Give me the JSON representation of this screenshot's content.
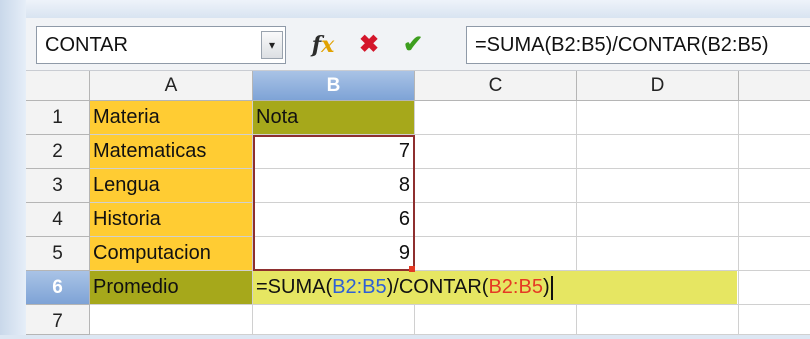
{
  "toolbar": {
    "name_box": "CONTAR",
    "dropdown_glyph": "▾",
    "function_wizard_icon": "fx",
    "cancel_icon": "✖",
    "accept_icon": "✔",
    "formula": "=SUMA(B2:B5)/CONTAR(B2:B5)"
  },
  "columns": [
    "A",
    "B",
    "C",
    "D"
  ],
  "rows": [
    "1",
    "2",
    "3",
    "4",
    "5",
    "6",
    "7"
  ],
  "cells": {
    "A1": "Materia",
    "B1": "Nota",
    "A2": "Matematicas",
    "B2": "7",
    "A3": "Lengua",
    "B3": "8",
    "A4": "Historia",
    "B4": "6",
    "A5": "Computacion",
    "B5": "9",
    "A6": "Promedio"
  },
  "editing_formula": {
    "p1": "=SUMA(",
    "r1": "B2:B5",
    "p2": ")/CONTAR(",
    "r2": "B2:B5",
    "p3": ")"
  },
  "colors": {
    "label_fill": "#ffcc33",
    "header_fill": "#a6a81b",
    "edit_fill": "#e6e662",
    "ref_blue": "#2e5fd6",
    "ref_red": "#e53a24",
    "active_header": "#7ea3d6"
  }
}
